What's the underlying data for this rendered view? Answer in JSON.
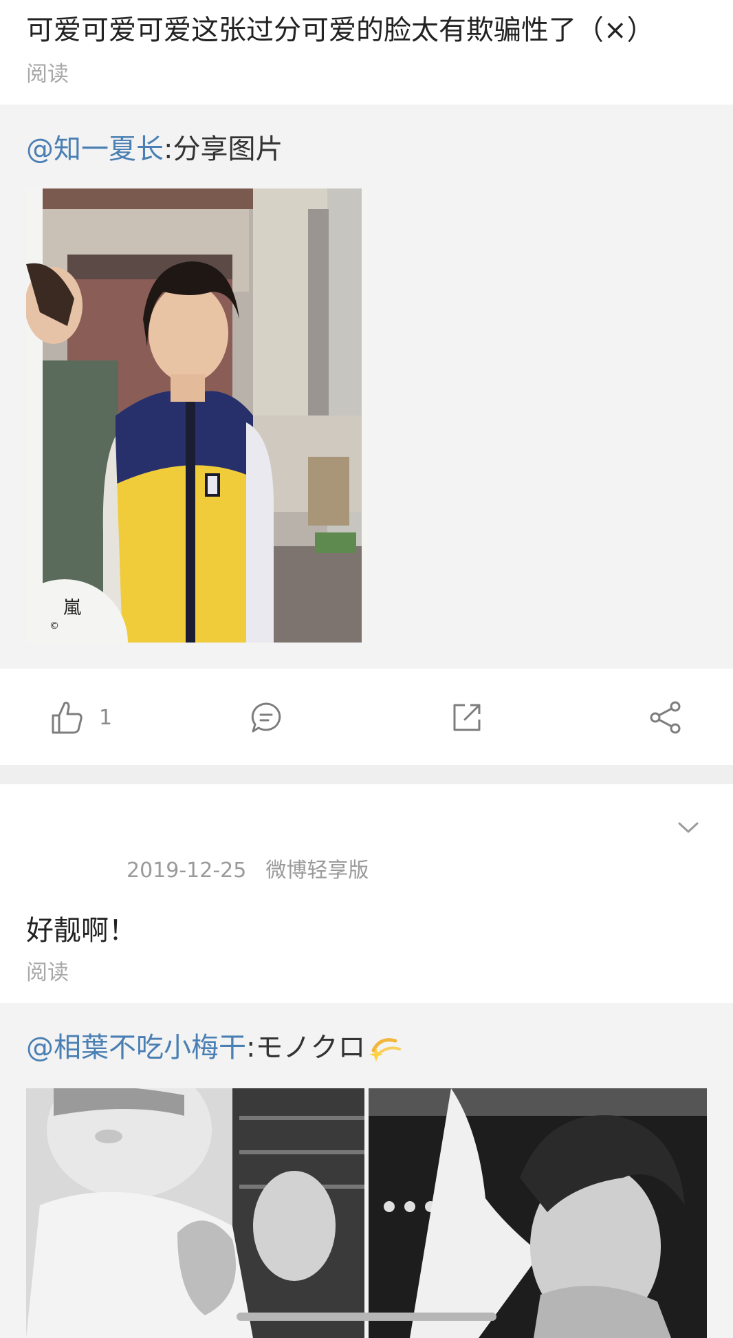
{
  "post1": {
    "text": "可爱可爱可爱这张过分可爱的脸太有欺骗性了（×）",
    "read_label": "阅读"
  },
  "repost1": {
    "mention": "@知一夏长",
    "text": ":分享图片"
  },
  "actions": {
    "like_count": "1"
  },
  "post2": {
    "date": "2019-12-25",
    "source": "微博轻享版",
    "text": "好靓啊！",
    "read_label": "阅读"
  },
  "repost2": {
    "mention": "@相葉不吃小梅干",
    "text": ":モノクロ"
  },
  "colors": {
    "mention": "#4a7fb3",
    "muted": "#a8a8a8",
    "background_gray": "#f3f3f3"
  }
}
